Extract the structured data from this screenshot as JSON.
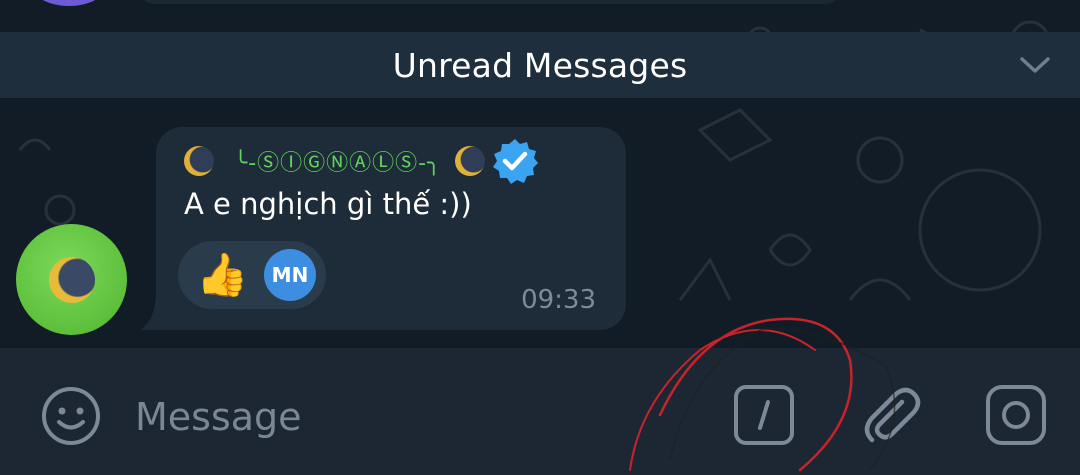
{
  "unread_divider": {
    "label": "Unread Messages"
  },
  "message": {
    "sender_name": "╰-ⓈⒾⒼⓃⒶⓁⓈ-╮",
    "text": "A e nghịch gì thế :))",
    "reaction_emoji": "👍",
    "reactor_initials": "MN",
    "time": "09:33"
  },
  "composer": {
    "placeholder": "Message"
  },
  "icons": {
    "unread_chevron": "chevron-down-icon",
    "verified": "verified-badge-icon",
    "emoji": "emoji-icon",
    "commands": "slash-command-icon",
    "attach": "paperclip-icon",
    "camera": "camera-icon"
  },
  "colors": {
    "sender_name": "#5fd35b",
    "verified_badge": "#3aa4f0",
    "avatar": "#5cc23a",
    "reactor": "#3d8ee0",
    "scribble": "#c8232a"
  }
}
